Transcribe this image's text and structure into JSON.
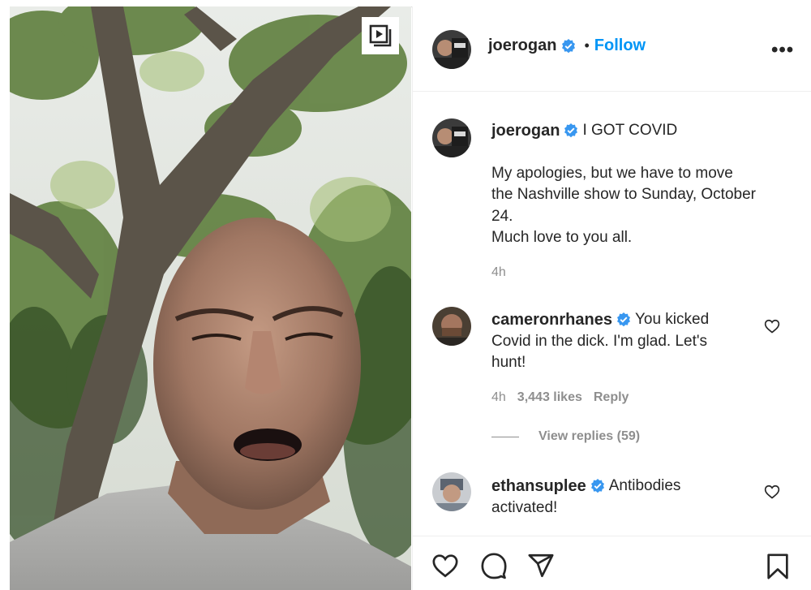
{
  "post": {
    "author": "joerogan",
    "follow_label": "Follow",
    "separator": "•",
    "more_label": "•••"
  },
  "caption": {
    "author": "joerogan",
    "title": "I GOT COVID",
    "body_line1": "My apologies, but we have to move",
    "body_line2": "the Nashville show to Sunday, October",
    "body_line3": "24.",
    "body_line4": "Much love to you all.",
    "time": "4h"
  },
  "comments": [
    {
      "author": "cameronrhanes",
      "text_line1": "You kicked",
      "text_line2": "Covid in the dick. I'm glad. Let's",
      "text_line3": "hunt!",
      "time": "4h",
      "likes": "3,443 likes",
      "reply_label": "Reply",
      "view_replies": "View replies (59)"
    },
    {
      "author": "ethansuplee",
      "text_line1": "Antibodies",
      "text_line2": "activated!"
    }
  ],
  "icons": {
    "video": "video-play-icon",
    "verified": "verified-badge-icon",
    "like": "heart-icon",
    "comment": "comment-bubble-icon",
    "share": "paper-plane-icon",
    "save": "bookmark-icon"
  },
  "colors": {
    "link_blue": "#0095f6",
    "verified_blue": "#3897f0",
    "muted": "#8e8e8e",
    "text": "#262626"
  }
}
